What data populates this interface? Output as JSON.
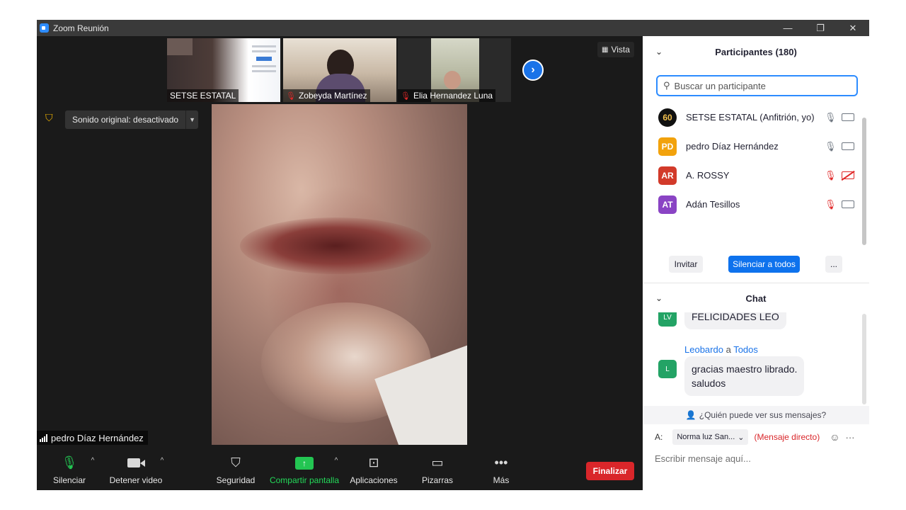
{
  "window": {
    "title": "Zoom Reunión",
    "minimize": "—",
    "restore": "❐",
    "close": "✕"
  },
  "thumbnails": [
    {
      "name": "SETSE ESTATAL",
      "muted": false
    },
    {
      "name": "Zobeyda Martínez",
      "muted": true
    },
    {
      "name": "Elia Hernandez Luna",
      "muted": true
    }
  ],
  "view_button": "Vista",
  "original_sound": "Sonido original: desactivado",
  "active_speaker": "pedro  Díaz Hernández",
  "toolbar": {
    "mute": "Silenciar",
    "stop_video": "Detener video",
    "security": "Seguridad",
    "share_screen": "Compartir pantalla",
    "apps": "Aplicaciones",
    "whiteboards": "Pizarras",
    "more": "Más",
    "end": "Finalizar"
  },
  "participants_panel": {
    "title": "Participantes (180)",
    "search_placeholder": "Buscar un participante",
    "items": [
      {
        "initials": "60",
        "name": "SETSE ESTATAL (Anfitrión, yo)",
        "color": "#1a1a1a",
        "mic_off": false,
        "cam_off": false
      },
      {
        "initials": "PD",
        "name": "pedro  Díaz Hernández",
        "color": "#f2a20c",
        "mic_off": false,
        "cam_off": false
      },
      {
        "initials": "AR",
        "name": "A. ROSSY",
        "color": "#d23a2a",
        "mic_off": true,
        "cam_off": true
      },
      {
        "initials": "AT",
        "name": "Adán Tesillos",
        "color": "#8a44c4",
        "mic_off": true,
        "cam_off": false
      }
    ],
    "invite": "Invitar",
    "mute_all": "Silenciar a todos",
    "more": "..."
  },
  "chat_panel": {
    "title": "Chat",
    "messages": [
      {
        "avatar": "LV",
        "text": "FELICIDADES LEO"
      },
      {
        "sender": "Leobardo",
        "to_word": "a",
        "recipient": "Todos",
        "avatar": "L",
        "text_line1": "gracias maestro librado.",
        "text_line2": "saludos"
      }
    ],
    "who_can_see": "¿Quién puede ver sus mensajes?",
    "to_label": "A:",
    "to_value": "Norma luz San...",
    "direct_message": "(Mensaje directo)",
    "input_placeholder": "Escribir mensaje aquí..."
  },
  "colors": {
    "accent": "#2d8cff",
    "end": "#d9262a",
    "share": "#23c552"
  }
}
